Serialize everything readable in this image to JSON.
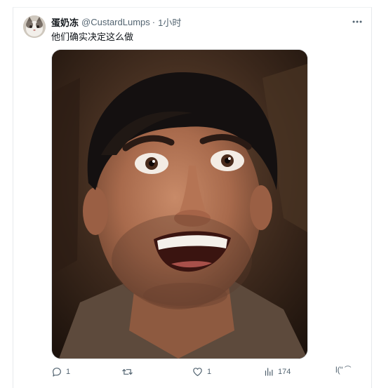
{
  "tweet": {
    "author_name": "蛋奶冻",
    "author_handle": "@CustardLumps",
    "separator": "·",
    "time": "1小时",
    "more_icon": "more-horizontal-icon",
    "text": "他们确实决定这么做",
    "media_alt": "Wide-eyed grinning man with black hair against a dark rocky background"
  },
  "actions": {
    "reply": {
      "icon": "reply-icon",
      "count": "1"
    },
    "retweet": {
      "icon": "retweet-icon",
      "count": ""
    },
    "like": {
      "icon": "heart-icon",
      "count": "1"
    },
    "views": {
      "icon": "views-icon",
      "count": "174"
    }
  },
  "watermark": "l(“ ͡"
}
